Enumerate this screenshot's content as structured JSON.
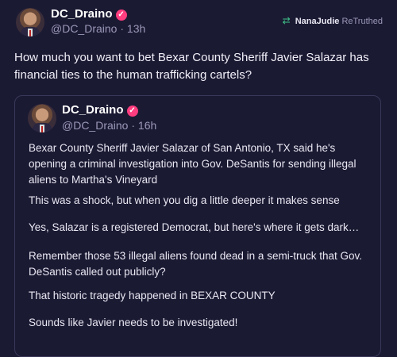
{
  "post": {
    "author": {
      "display_name": "DC_Draino",
      "handle": "@DC_Draino",
      "time": "· 13h",
      "verified_icon": "check-badge-icon"
    },
    "retruth": {
      "icon": "retruth-icon",
      "user": "NanaJudie",
      "label": "ReTruthed"
    },
    "text": "How much you want to bet Bexar County Sheriff Javier Salazar has financial ties to the human trafficking cartels?"
  },
  "quoted": {
    "author": {
      "display_name": "DC_Draino",
      "handle": "@DC_Draino",
      "time": "· 16h",
      "verified_icon": "check-badge-icon"
    },
    "paragraphs": [
      "Bexar County Sheriff Javier Salazar of San Antonio, TX said he's opening a criminal investigation into Gov. DeSantis for sending illegal aliens to Martha's Vineyard",
      "This was a shock, but when you dig a little deeper it makes sense",
      "Yes, Salazar is a registered Democrat, but here's where it gets dark…",
      "Remember those 53 illegal aliens found dead in a semi-truck that Gov. DeSantis called out publicly?",
      "That historic tragedy happened in BEXAR COUNTY",
      "Sounds like Javier needs to be investigated!"
    ]
  },
  "colors": {
    "background": "#1b1a33",
    "verified_badge": "#ff3d7f",
    "retruth_icon": "#3ec58a",
    "muted_text": "#9b98b8"
  }
}
